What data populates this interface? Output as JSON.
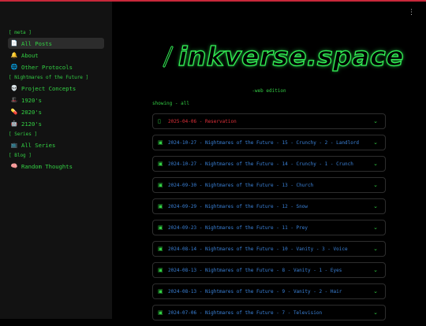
{
  "sidebar": {
    "sections": [
      {
        "label": "[ meta ]",
        "items": [
          {
            "icon": "📄",
            "label": "All Posts",
            "active": true
          },
          {
            "icon": "🔔",
            "label": "About"
          },
          {
            "icon": "🌐",
            "label": "Other Protocols"
          }
        ]
      },
      {
        "label": "[ Nightmares of the Future ]",
        "items": [
          {
            "icon": "💀",
            "label": "Project Concepts"
          },
          {
            "icon": "🎩",
            "label": "1920's"
          },
          {
            "icon": "💊",
            "label": "2020's"
          },
          {
            "icon": "🤖",
            "label": "2120's"
          }
        ]
      },
      {
        "label": "[ Series ]",
        "items": [
          {
            "icon": "📺",
            "label": "All Series"
          }
        ]
      },
      {
        "label": "[ Blog ]",
        "items": [
          {
            "icon": "🧠",
            "label": "Random Thoughts"
          }
        ]
      }
    ]
  },
  "header": {
    "menu_icon": "⋮",
    "logo_icon": "pen-icon",
    "site_title": "inkverse.space",
    "edition": "-web edition",
    "showing": "showing - all"
  },
  "posts": [
    {
      "label": "2025-04-06 - Reservation",
      "icon": "document-icon",
      "color": "#e0303a"
    },
    {
      "label": "2024-10-27 - Nightmares of the Future - 15 - Crunchy - 2 - Landlord",
      "icon": "book-icon",
      "color": "#3b82d8"
    },
    {
      "label": "2024-10-27 - Nightmares of the Future - 14 - Crunchy - 1 - Crunch",
      "icon": "book-icon",
      "color": "#3b82d8"
    },
    {
      "label": "2024-09-30 - Nightmares of the Future - 13 - Church",
      "icon": "book-icon",
      "color": "#3b82d8"
    },
    {
      "label": "2024-09-29 - Nightmares of the Future - 12 - Snow",
      "icon": "book-icon",
      "color": "#3b82d8"
    },
    {
      "label": "2024-09-23 - Nightmares of the Future - 11 - Prey",
      "icon": "book-icon",
      "color": "#3b82d8"
    },
    {
      "label": "2024-08-14 - Nightmares of the Future - 10 - Vanity - 3 - Voice",
      "icon": "book-icon",
      "color": "#3b82d8"
    },
    {
      "label": "2024-08-13 - Nightmares of the Future - 8 - Vanity - 1 - Eyes",
      "icon": "book-icon",
      "color": "#3b82d8"
    },
    {
      "label": "2024-08-13 - Nightmares of the Future - 9 - Vanity - 2 - Hair",
      "icon": "book-icon",
      "color": "#3b82d8"
    },
    {
      "label": "2024-07-06 - Nightmares of the Future - 7 - Television",
      "icon": "book-icon",
      "color": "#3b82d8"
    }
  ],
  "colors": {
    "accent": "#33d044",
    "link": "#3b82d8",
    "alert": "#e0303a",
    "top_bar": "#c8283a"
  }
}
